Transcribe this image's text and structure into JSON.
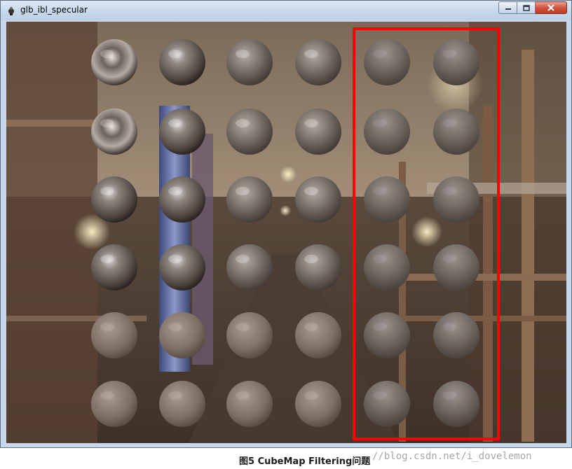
{
  "window": {
    "title": "glb_ibl_specular",
    "icon": "app-icon",
    "controls": [
      "minimize-icon",
      "maximize-icon",
      "close-icon"
    ],
    "close_color": "#c8412a"
  },
  "render": {
    "grid": {
      "rows": 6,
      "cols": 6
    },
    "highlight": {
      "columns": [
        5,
        6
      ],
      "color": "#ff0000"
    }
  },
  "caption": {
    "figure_label": "图5 CubeMap Filtering问题",
    "watermark": "//blog.csdn.net/i_dovelemon"
  }
}
